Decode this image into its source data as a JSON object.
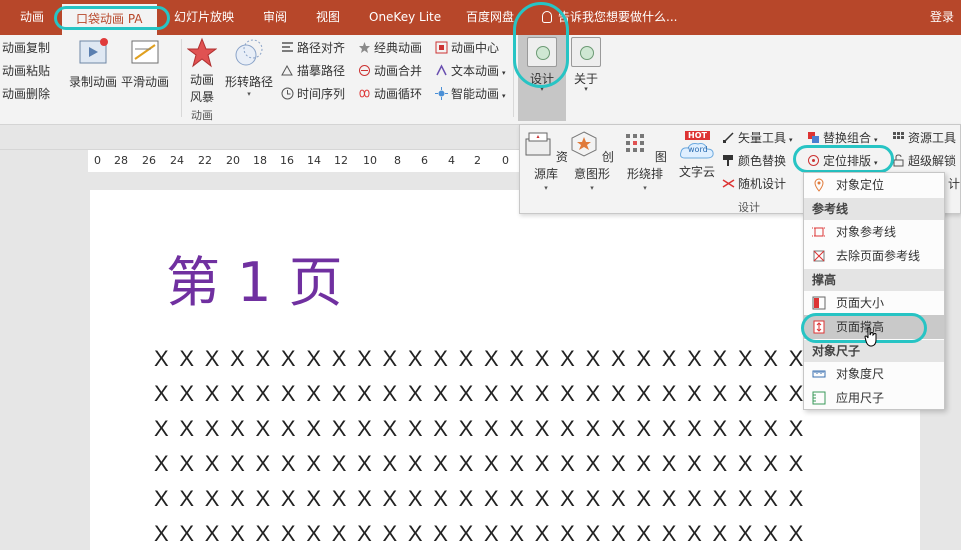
{
  "tabs": [
    {
      "label": "动画"
    },
    {
      "label": "口袋动画 PA"
    },
    {
      "label": "幻灯片放映"
    },
    {
      "label": "审阅"
    },
    {
      "label": "视图"
    },
    {
      "label": "OneKey Lite"
    },
    {
      "label": "百度网盘"
    }
  ],
  "tell_me": "告诉我您想要做什么...",
  "login": "登录",
  "ribbon": {
    "copy": "动画复制",
    "paste": "动画粘贴",
    "delete": "动画删除",
    "record": "录制动画",
    "smooth": "平滑动画",
    "storm_l1": "动画",
    "storm_l2": "风暴",
    "morph": "形转路径",
    "path_align": "路径对齐",
    "sketch_path": "描摹路径",
    "timeline": "时间序列",
    "classic": "经典动画",
    "merge": "动画合并",
    "loop": "动画循环",
    "center": "动画中心",
    "text_anim": "文本动画",
    "smart_anim": "智能动画",
    "group_label": "动画",
    "design": "设计",
    "about": "关于"
  },
  "ruler_ticks": [
    "0",
    "28",
    "26",
    "24",
    "22",
    "20",
    "18",
    "16",
    "14",
    "12",
    "10",
    "8",
    "6",
    "4",
    "2",
    "0"
  ],
  "slide": {
    "title": "第 1 页",
    "rows": [
      "X X X X X X X X X X X X X X X X X X X X X X X X X X",
      "X X X X X X X X X X X X X X X X X X X X X X X X X X",
      "X X X X X X X X X X X X X X X X X X X X X X X X X X",
      "X X X X X X X X X X X X X X X X X X X X X X X X X X",
      "X X X X X X X X X X X X X X X X X X X X X X X X X X",
      "X X X X X X X X X X X X X X X X X X X X X X X X X X"
    ]
  },
  "design_panel": {
    "library": "资源库",
    "creative": "创意图形",
    "layout": "图形绕排",
    "wordcloud": "文字云",
    "hot_badge": "HOT",
    "word_badge": "word",
    "vector": "矢量工具",
    "color_replace": "颜色替换",
    "random": "随机设计",
    "replace_combo": "替换组合",
    "position": "定位排版",
    "res_tool": "资源工具",
    "super_unlock": "超级解锁",
    "group_label": "设计",
    "truncated": "计"
  },
  "menu": {
    "obj_position": "对象定位",
    "hdr_guides": "参考线",
    "obj_guides": "对象参考线",
    "remove_guides": "去除页面参考线",
    "hdr_stretch": "撑高",
    "page_size": "页面大小",
    "page_stretch": "页面撑高",
    "hdr_ruler": "对象尺子",
    "obj_ruler": "对象度尺",
    "apply_ruler": "应用尺子"
  },
  "colors": {
    "tabbar": "#b7472a",
    "highlight": "#27c4c4",
    "title_purple": "#7030a0"
  }
}
